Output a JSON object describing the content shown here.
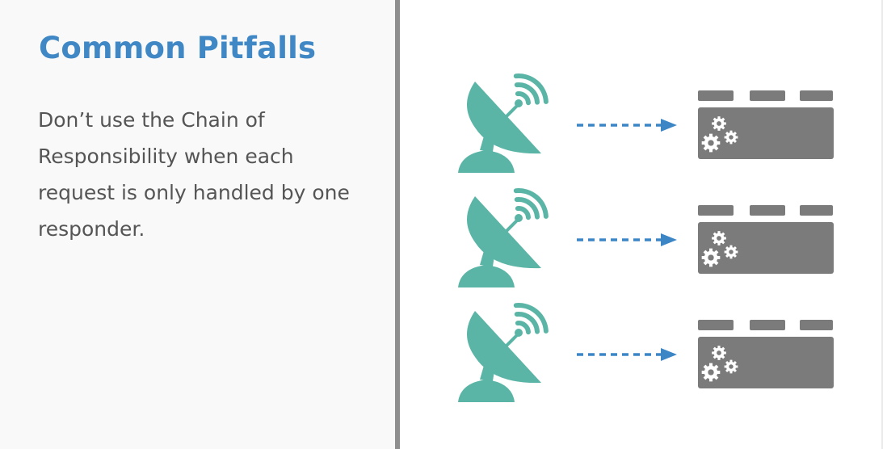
{
  "slide": {
    "title": "Common Pitfalls",
    "body": "Don’t use the Chain of Responsibility when each request is only handled by one responder."
  },
  "diagram": {
    "rows": [
      {
        "sender": "satellite-dish-icon",
        "connector": "dashed-arrow",
        "receiver": "server-gears-icon"
      },
      {
        "sender": "satellite-dish-icon",
        "connector": "dashed-arrow",
        "receiver": "server-gears-icon"
      },
      {
        "sender": "satellite-dish-icon",
        "connector": "dashed-arrow",
        "receiver": "server-gears-icon"
      }
    ],
    "colors": {
      "title": "#3f88c5",
      "text": "#555555",
      "dish": "#5bb5a6",
      "arrow": "#3d86c6",
      "server": "#7b7b7b",
      "gear": "#ffffff",
      "divider": "#8f8f8f"
    }
  }
}
